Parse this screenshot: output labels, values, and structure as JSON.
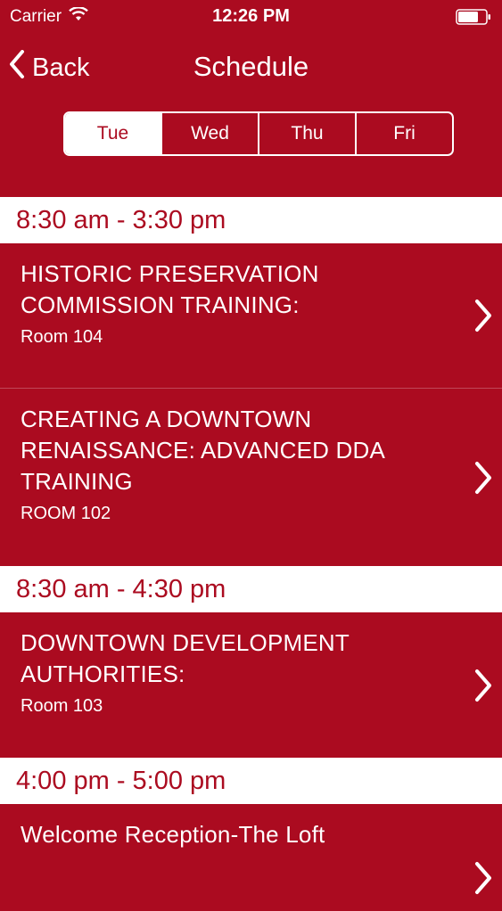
{
  "status": {
    "carrier": "Carrier",
    "time": "12:26 PM"
  },
  "nav": {
    "back_label": "Back",
    "title": "Schedule"
  },
  "days": [
    "Tue",
    "Wed",
    "Thu",
    "Fri"
  ],
  "selected_day": "Tue",
  "sections": [
    {
      "time": "8:30 am - 3:30 pm",
      "items": [
        {
          "title": "HISTORIC PRESERVATION COMMISSION TRAINING:",
          "room": "Room 104"
        },
        {
          "title": "CREATING A DOWNTOWN RENAISSANCE: ADVANCED DDA TRAINING",
          "room": "ROOM 102"
        }
      ]
    },
    {
      "time": "8:30 am - 4:30 pm",
      "items": [
        {
          "title": "DOWNTOWN DEVELOPMENT AUTHORITIES:",
          "room": "Room 103"
        }
      ]
    },
    {
      "time": "4:00 pm - 5:00 pm",
      "items": [
        {
          "title": "Welcome Reception-The Loft",
          "room": ""
        }
      ]
    }
  ],
  "colors": {
    "brand": "#ab0b20",
    "text": "#ffffff"
  },
  "icons": {
    "wifi": "wifi-icon",
    "battery": "battery-icon",
    "back": "chevron-left-icon",
    "disclosure": "chevron-right-icon"
  }
}
